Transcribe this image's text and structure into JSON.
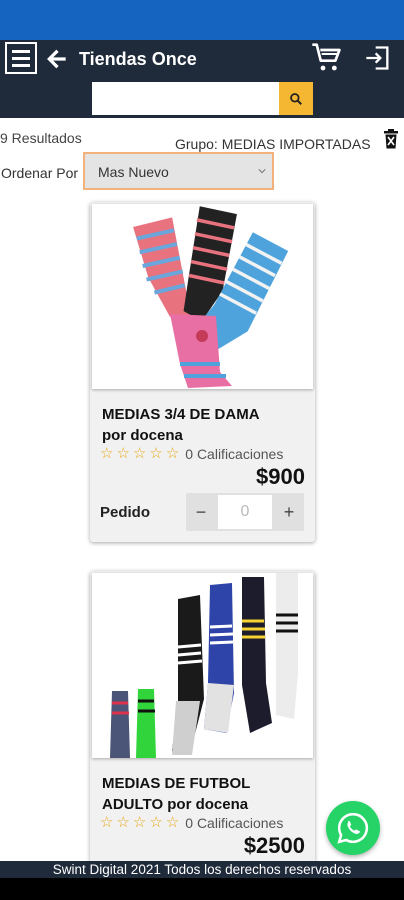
{
  "header": {
    "title": "Tiendas Once",
    "icons": {
      "menu": "menu-icon",
      "back": "arrow-left-icon",
      "cart": "cart-icon",
      "logout": "logout-icon"
    }
  },
  "search": {
    "value": "",
    "placeholder": "",
    "icon": "search-icon"
  },
  "results": {
    "count_text": "9 Resultados",
    "group_text": "Grupo: MEDIAS IMPORTADAS",
    "clear_icon": "trash-icon"
  },
  "sort": {
    "label": "Ordenar Por",
    "selected": "Mas Nuevo"
  },
  "products": [
    {
      "name_line1": "MEDIAS 3/4 DE DAMA",
      "name_line2": "por docena",
      "rating_text": "0 Calificaciones",
      "price": "$900",
      "order_label": "Pedido",
      "qty_value": "0",
      "minus": "−",
      "plus": "+"
    },
    {
      "name_line1": "MEDIAS DE FUTBOL",
      "name_line2": "ADULTO por docena",
      "rating_text": "0 Calificaciones",
      "price": "$2500"
    }
  ],
  "footer": {
    "text": "Swint Digital 2021 Todos los derechos reservados"
  },
  "colors": {
    "status_bar": "#1565c0",
    "header": "#1f2a3a",
    "accent": "#f5b731",
    "whatsapp": "#25d366"
  }
}
